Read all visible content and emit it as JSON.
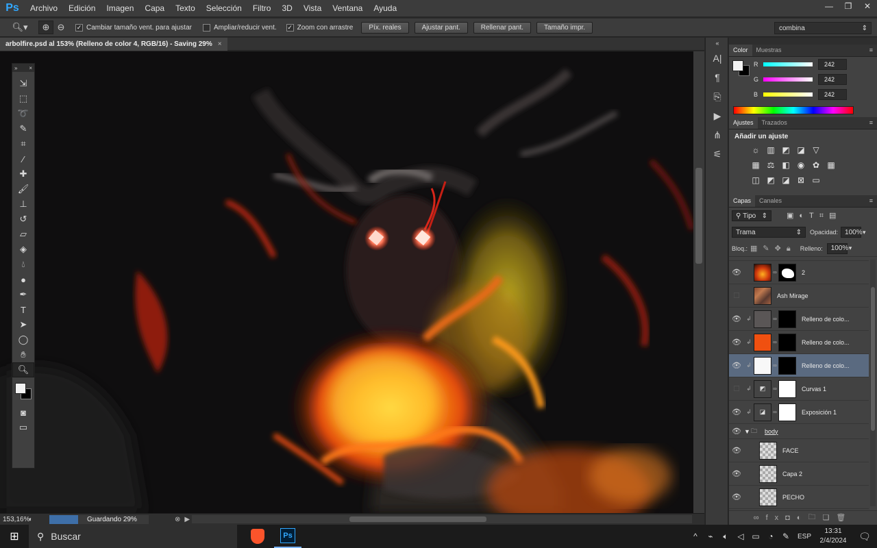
{
  "app": {
    "logo": "Ps"
  },
  "menu": [
    "Archivo",
    "Edición",
    "Imagen",
    "Capa",
    "Texto",
    "Selección",
    "Filtro",
    "3D",
    "Vista",
    "Ventana",
    "Ayuda"
  ],
  "options": {
    "checkboxes": [
      {
        "label": "Cambiar tamaño vent. para ajustar",
        "checked": true
      },
      {
        "label": "Ampliar/reducir vent.",
        "checked": false
      },
      {
        "label": "Zoom con arrastre",
        "checked": true
      }
    ],
    "buttons": [
      "Píx. reales",
      "Ajustar pant.",
      "Rellenar pant.",
      "Tamaño impr."
    ],
    "workspace": "combina"
  },
  "document": {
    "tab_title": "arbolfire.psd al 153% (Relleno de color 4, RGB/16) - Saving 29%",
    "close": "×"
  },
  "status": {
    "zoom": "153,16%",
    "progress_label": "Guardando 29%",
    "progress": 0.29
  },
  "color_panel": {
    "tabs": [
      "Color",
      "Muestras"
    ],
    "channels": [
      {
        "label": "R",
        "value": "242"
      },
      {
        "label": "G",
        "value": "242"
      },
      {
        "label": "B",
        "value": "242"
      }
    ],
    "foreground": "#f2f2f2"
  },
  "adjustments_panel": {
    "tabs": [
      "Ajustes",
      "Trazados"
    ],
    "title": "Añadir un ajuste"
  },
  "layers_panel": {
    "tabs": [
      "Capas",
      "Canales"
    ],
    "filter": "Tipo",
    "blend_mode": "Trama",
    "opacity_label": "Opacidad:",
    "opacity": "100%",
    "lock_label": "Bloq.:",
    "fill_label": "Relleno:",
    "fill": "100%",
    "layers": [
      {
        "name": "2",
        "visible": true,
        "clipped": false,
        "selected": false
      },
      {
        "name": "Ash Mirage",
        "visible": false,
        "clipped": false,
        "selected": false
      },
      {
        "name": "Relleno de colo...",
        "visible": true,
        "clipped": true,
        "selected": false
      },
      {
        "name": "Relleno de colo...",
        "visible": true,
        "clipped": true,
        "selected": false
      },
      {
        "name": "Relleno de colo...",
        "visible": true,
        "clipped": true,
        "selected": true
      },
      {
        "name": "Curvas 1",
        "visible": false,
        "clipped": true,
        "selected": false
      },
      {
        "name": "Exposición 1",
        "visible": true,
        "clipped": true,
        "selected": false
      },
      {
        "name": "body",
        "visible": true,
        "clipped": false,
        "selected": false,
        "group": true
      },
      {
        "name": "FACE",
        "visible": true,
        "clipped": false,
        "selected": false
      },
      {
        "name": "Capa 2",
        "visible": true,
        "clipped": false,
        "selected": false
      },
      {
        "name": "PECHO",
        "visible": true,
        "clipped": false,
        "selected": false
      }
    ]
  },
  "taskbar": {
    "search": "Buscar",
    "language": "ESP",
    "time": "13:31",
    "date": "2/4/2024"
  }
}
